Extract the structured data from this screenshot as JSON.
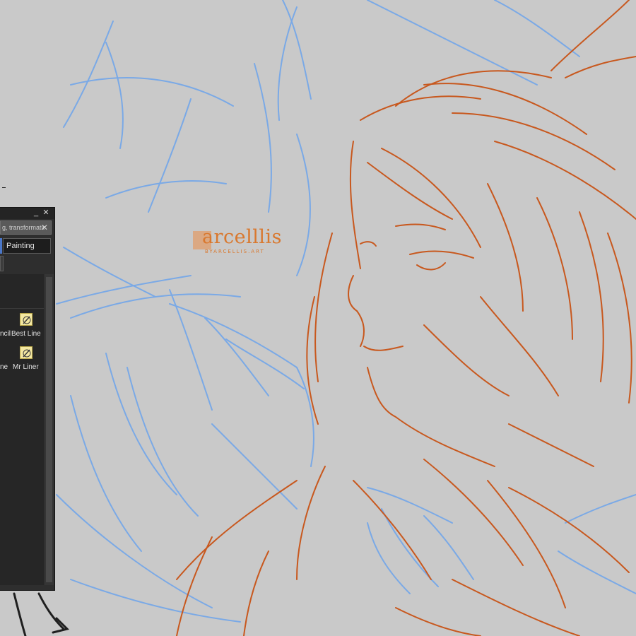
{
  "canvas": {
    "background_color": "#c9c9c9",
    "sketch_blue": "#7aa9e6",
    "sketch_orange": "#c8581e"
  },
  "watermark": {
    "logo_text": "arcelllis",
    "sub_text": "BYARCELLIS.ART",
    "color": "#d9782e"
  },
  "palette": {
    "window_buttons": {
      "minimize": "_",
      "close": "✕"
    },
    "search": {
      "value": "",
      "placeholder": "g, transformation",
      "clear_icon": "close-icon"
    },
    "group_tab": "Painting",
    "tools": [
      {
        "label": "ncil",
        "icon": "brush-icon"
      },
      {
        "label": "Best Line",
        "icon": "brush-icon"
      },
      {
        "label": "ne",
        "icon": "brush-icon"
      },
      {
        "label": "Mr Liner",
        "icon": "brush-icon"
      }
    ]
  }
}
